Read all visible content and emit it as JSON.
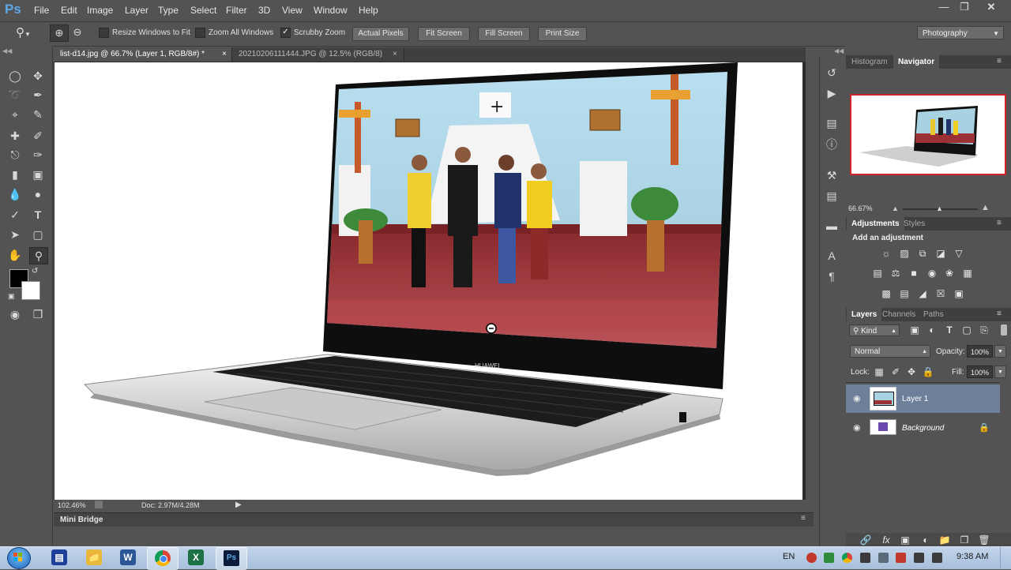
{
  "app": {
    "logo": "Ps",
    "menus": [
      "File",
      "Edit",
      "Image",
      "Layer",
      "Type",
      "Select",
      "Filter",
      "3D",
      "View",
      "Window",
      "Help"
    ]
  },
  "options": {
    "resize_windows": "Resize Windows to Fit",
    "zoom_all": "Zoom All Windows",
    "scrubby_zoom": "Scrubby Zoom",
    "actual_pixels": "Actual Pixels",
    "fit_screen": "Fit Screen",
    "fill_screen": "Fill Screen",
    "print_size": "Print Size",
    "workspace": "Photography"
  },
  "tabs": [
    {
      "label": "list-d14.jpg @ 66.7% (Layer 1, RGB/8#) *",
      "close": "×"
    },
    {
      "label": "20210206111444.JPG @ 12.5% (RGB/8)",
      "close": "×"
    }
  ],
  "status": {
    "zoom": "102.46%",
    "doc": "Doc: 2.97M/4.28M"
  },
  "mini_bridge": "Mini Bridge",
  "navigator": {
    "tab_histogram": "Histogram",
    "tab_navigator": "Navigator",
    "zoom": "66.67%"
  },
  "adjustments": {
    "tab_adjustments": "Adjustments",
    "tab_styles": "Styles",
    "title": "Add an adjustment"
  },
  "layers": {
    "tab_layers": "Layers",
    "tab_channels": "Channels",
    "tab_paths": "Paths",
    "kind": "Kind",
    "blend_mode": "Normal",
    "opacity_label": "Opacity:",
    "opacity": "100%",
    "lock_label": "Lock:",
    "fill_label": "Fill:",
    "fill": "100%",
    "items": [
      {
        "name": "Layer 1"
      },
      {
        "name": "Background"
      }
    ]
  },
  "canvas_image": {
    "brand": "HUAWEI"
  },
  "taskbar": {
    "lang": "EN",
    "time": "9:38 AM"
  },
  "colors": {
    "panel_bg": "#535353",
    "selected_layer": "#6d7f99",
    "accent_blue": "#5ea9e8"
  }
}
